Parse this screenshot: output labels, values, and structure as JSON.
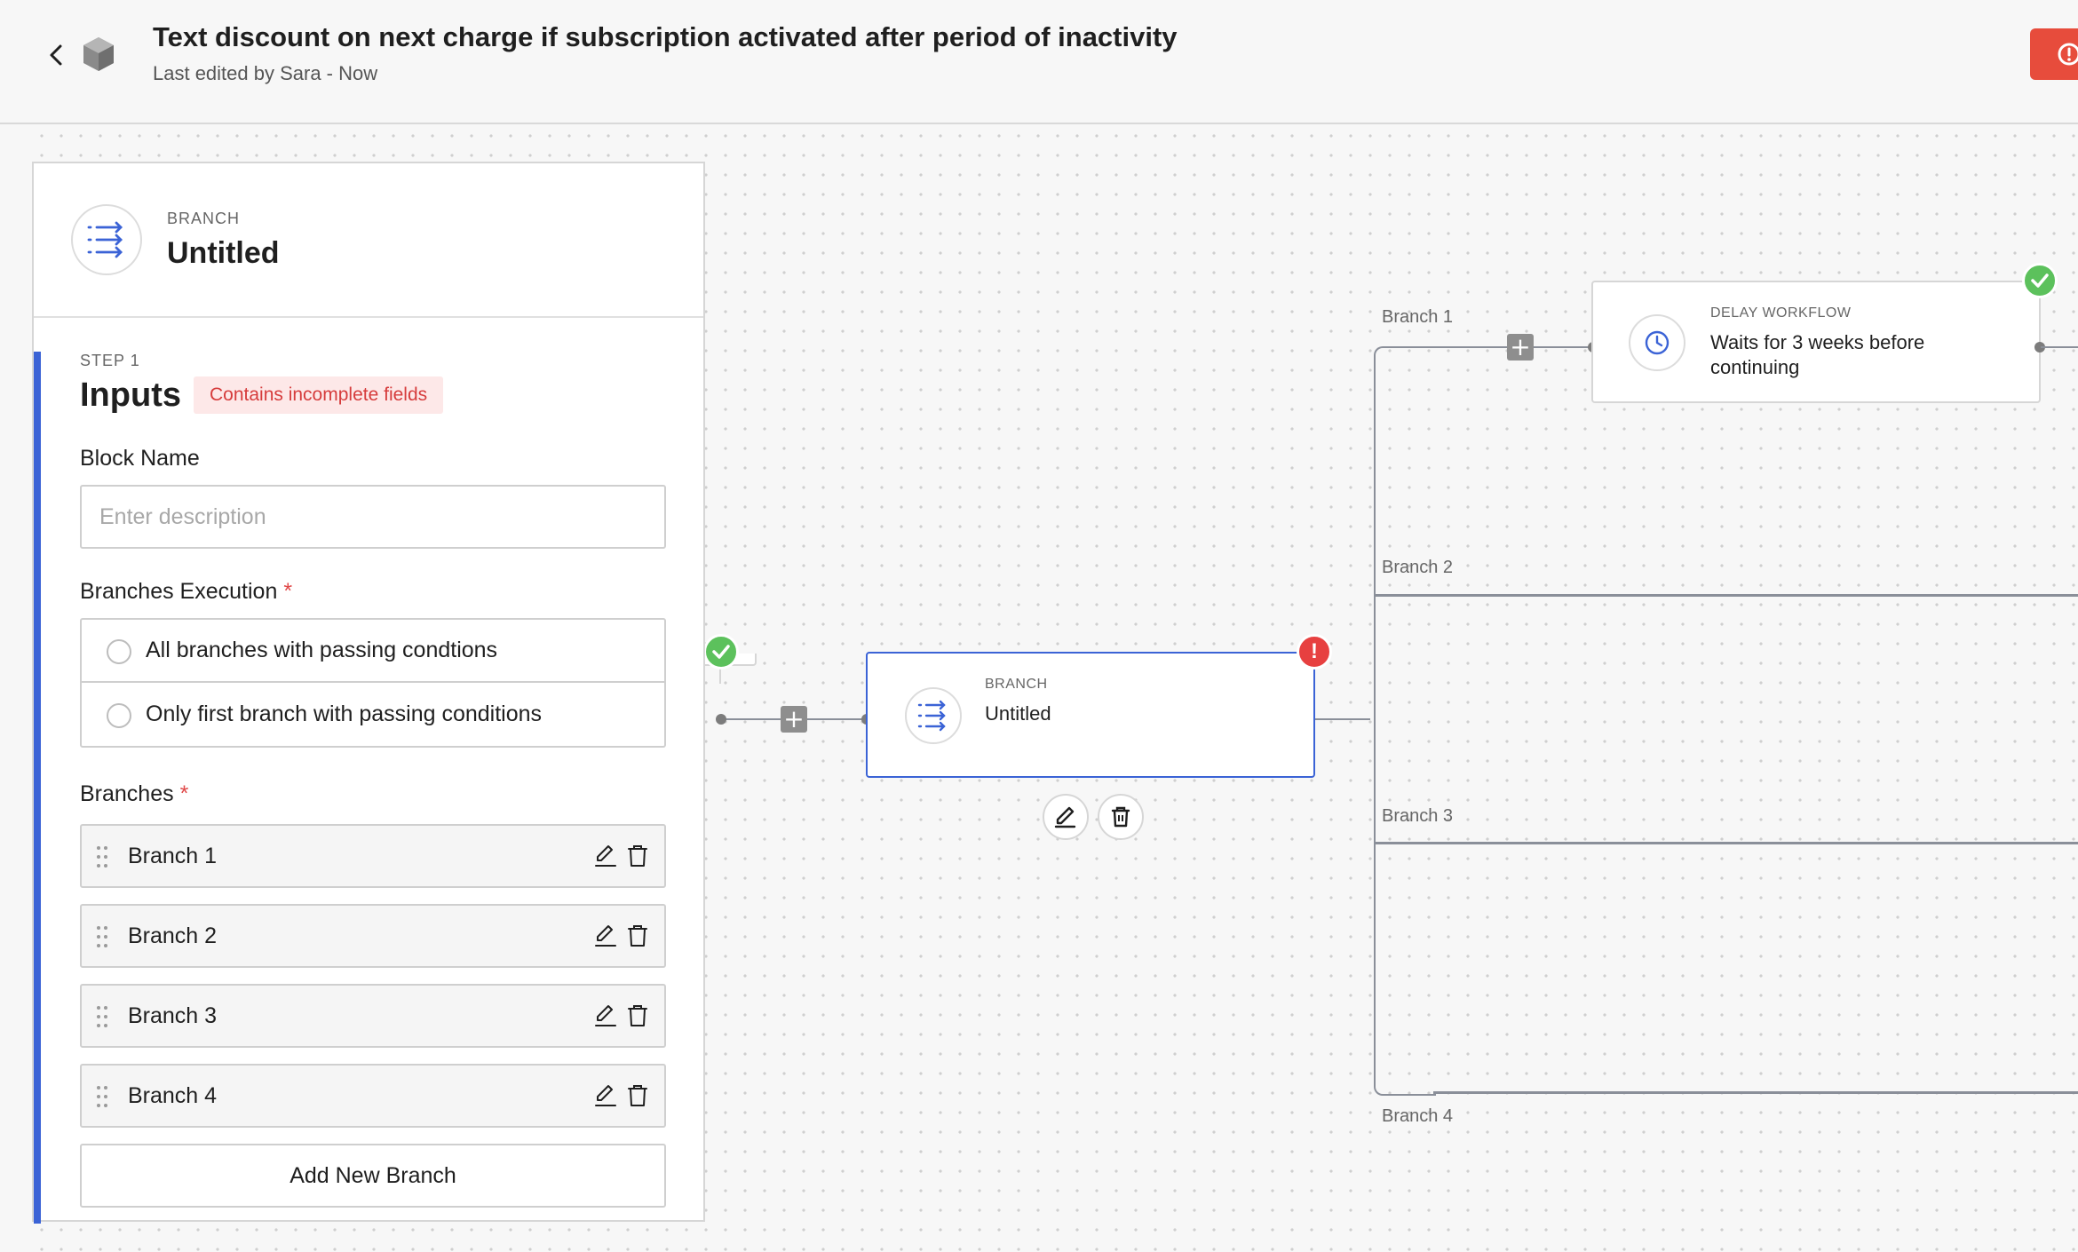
{
  "header": {
    "title": "Text discount on next charge if subscription activated after period of inactivity",
    "subtitle": "Last edited by Sara - Now"
  },
  "panel": {
    "type_label": "BRANCH",
    "title": "Untitled",
    "step_label": "STEP 1",
    "step_title": "Inputs",
    "warning": "Contains incomplete fields",
    "block_name_label": "Block Name",
    "block_name_placeholder": "Enter description",
    "block_name_value": "",
    "execution_label": "Branches Execution",
    "execution_options": [
      {
        "label": "All branches with passing condtions",
        "selected": false
      },
      {
        "label": "Only first branch with passing conditions",
        "selected": false
      }
    ],
    "branches_label": "Branches",
    "required_mark": "*",
    "branches": [
      {
        "name": "Branch 1"
      },
      {
        "name": "Branch 2"
      },
      {
        "name": "Branch 3"
      },
      {
        "name": "Branch 4"
      }
    ],
    "add_branch_label": "Add New Branch"
  },
  "canvas": {
    "branch_node": {
      "type_label": "BRANCH",
      "title": "Untitled",
      "status": "error",
      "badge_text": "!"
    },
    "delay_node": {
      "type_label": "DELAY WORKFLOW",
      "title": "Waits for 3 weeks before continuing",
      "status": "ok"
    },
    "branch_labels": [
      "Branch 1",
      "Branch 2",
      "Branch 3",
      "Branch 4"
    ],
    "plus_symbol": "+"
  },
  "colors": {
    "accent": "#3b63d6",
    "error": "#e74040",
    "success": "#5cc15c",
    "warning_bg": "#fde8e8",
    "warning_text": "#d63c3c"
  },
  "icons": {
    "back": "chevron-left-icon",
    "logo": "cube-icon",
    "alert": "alert-circle-icon",
    "branch": "branch-list-icon",
    "delay": "clock-icon",
    "edit": "pencil-icon",
    "delete": "trash-icon",
    "drag": "drag-handle-icon",
    "ok": "check-icon"
  }
}
